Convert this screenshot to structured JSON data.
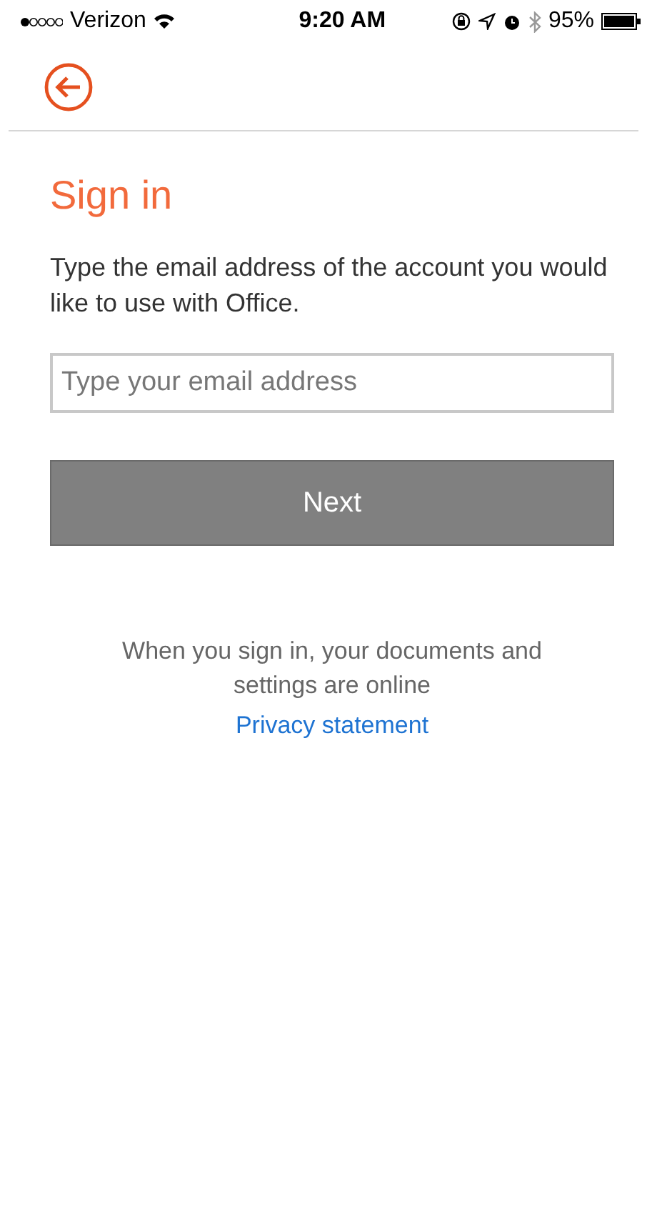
{
  "status_bar": {
    "carrier": "Verizon",
    "time": "9:20 AM",
    "battery": "95%"
  },
  "title": "Sign in",
  "description": "Type the email address of the account you would like to use with Office.",
  "email_field": {
    "placeholder": "Type your email address"
  },
  "next_button": "Next",
  "note": "When you sign in, your documents and settings are online",
  "privacy_link": "Privacy statement"
}
